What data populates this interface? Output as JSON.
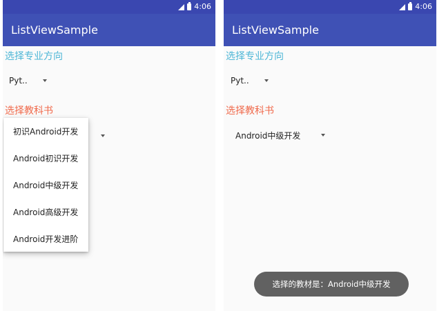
{
  "status_bar": {
    "time": "4:06"
  },
  "app": {
    "title": "ListViewSample"
  },
  "left": {
    "major_label": "选择专业方向",
    "major_spinner_value": "Pyt..",
    "book_label": "选择教科书",
    "dropdown_items": [
      "初识Android开发",
      "Android初识开发",
      "Android中级开发",
      "Android高级开发",
      "Android开发进阶"
    ]
  },
  "right": {
    "major_label": "选择专业方向",
    "major_spinner_value": "Pyt..",
    "book_label": "选择教科书",
    "book_spinner_value": "Android中级开发",
    "toast": "选择的教材是：Android中级开发"
  },
  "colors": {
    "app_bar": "#3f51b5",
    "status_bar": "#3a47b0",
    "label_blue": "#4db6d6",
    "label_red": "#f06a4c",
    "toast_bg": "#616161"
  },
  "icons": [
    "signal-icon",
    "battery-icon",
    "dropdown-arrow-icon"
  ]
}
